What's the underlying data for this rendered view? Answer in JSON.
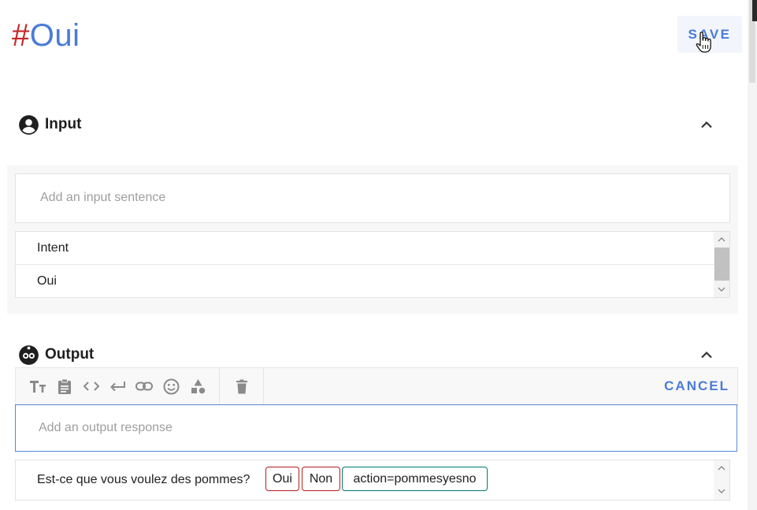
{
  "header": {
    "hash": "#",
    "intent_name": "Oui",
    "save_label": "SAVE"
  },
  "input_section": {
    "label": "Input",
    "placeholder": "Add an input sentence",
    "rows": [
      "Intent",
      "Oui"
    ]
  },
  "output_section": {
    "label": "Output",
    "cancel_label": "CANCEL",
    "placeholder": "Add an output response",
    "response": {
      "text": "Est-ce que vous voulez des pommes?",
      "chips": [
        {
          "label": "Oui",
          "kind": "option"
        },
        {
          "label": "Non",
          "kind": "option"
        },
        {
          "label": "action=pommesyesno",
          "kind": "action"
        }
      ]
    }
  },
  "toolbar_icons": [
    "text-format-icon",
    "clipboard-icon",
    "code-icon",
    "return-icon",
    "link-icon",
    "emoji-icon",
    "shapes-icon",
    "trash-icon"
  ],
  "colors": {
    "accent": "#4a7bd9",
    "hash": "#c62828",
    "chip_option": "#b71c1c",
    "chip_action": "#00796b"
  }
}
